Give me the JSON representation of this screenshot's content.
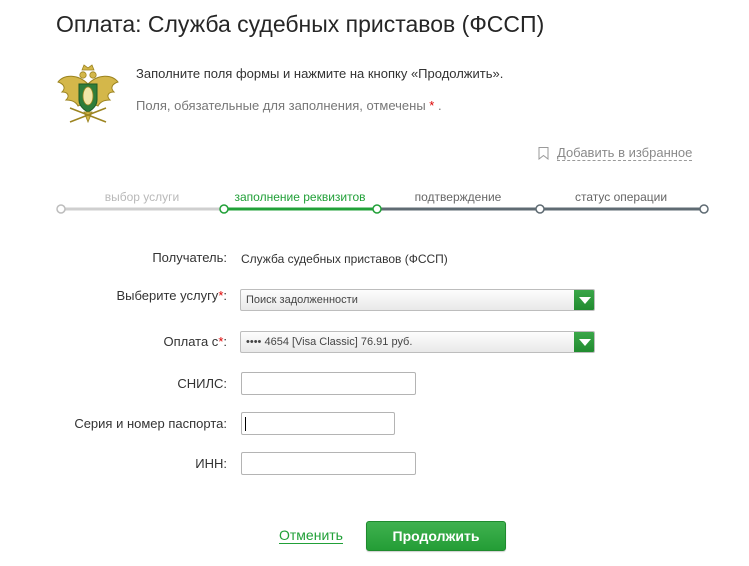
{
  "page": {
    "title": "Оплата: Служба судебных приставов (ФССП)"
  },
  "intro": {
    "line1": "Заполните поля формы и нажмите на кнопку «Продолжить».",
    "line2_prefix": "Поля, обязательные для заполнения, отмечены",
    "required_mark": "*",
    "line2_suffix": "."
  },
  "favorite": {
    "label": "Добавить в избранное",
    "icon": "bookmark-icon"
  },
  "steps": [
    {
      "label": "выбор услуги",
      "state": "done"
    },
    {
      "label": "заполнение реквизитов",
      "state": "active"
    },
    {
      "label": "подтверждение",
      "state": "todo"
    },
    {
      "label": "статус операции",
      "state": "todo"
    }
  ],
  "form": {
    "recipient_label": "Получатель:",
    "recipient_value": "Служба судебных приставов (ФССП)",
    "service_label": "Выберите услугу",
    "service_value": "Поиск задолженности",
    "payfrom_label": "Оплата с",
    "payfrom_value": "•••• 4654 [Visa Classic] 76.91 руб.",
    "required_mark": "*",
    "colon": ":",
    "snils_label": "СНИЛС:",
    "snils_value": "",
    "passport_label": "Серия и номер паспорта:",
    "passport_value": "",
    "inn_label": "ИНН:",
    "inn_value": ""
  },
  "actions": {
    "cancel_label": "Отменить",
    "continue_label": "Продолжить"
  },
  "colors": {
    "accent_green": "#21a038",
    "required_red": "#dd0000",
    "inactive_gray": "#b9b9b9",
    "track_dark": "#5f6b73"
  }
}
